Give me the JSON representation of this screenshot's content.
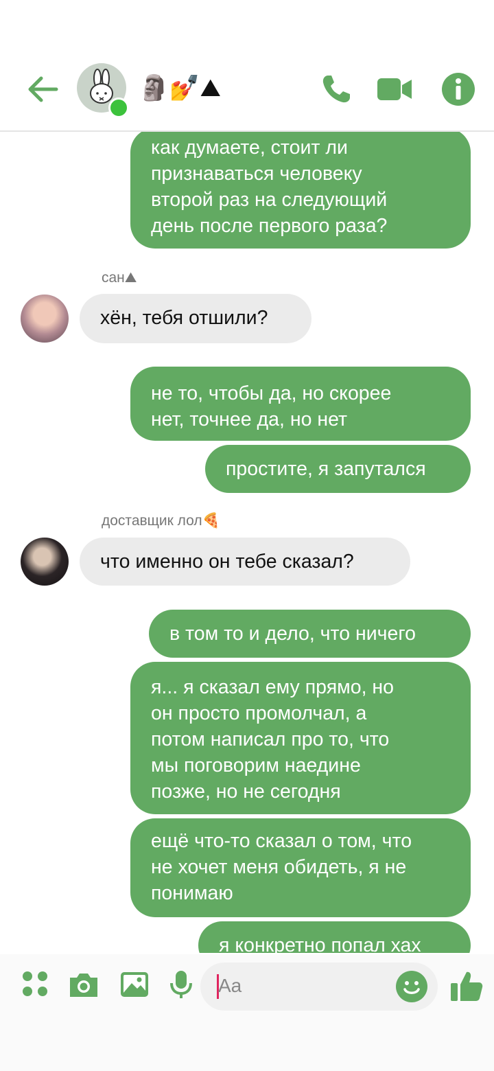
{
  "header": {
    "title_emojis": "🗿💅⛰",
    "back_icon": "arrow-left-icon",
    "call_icon": "phone-icon",
    "video_icon": "video-camera-icon",
    "info_icon": "info-icon"
  },
  "messages": [
    {
      "dir": "out",
      "lines": [
        "как думаете, стоит ли",
        "признаваться человеку",
        "второй раз на следующий",
        "день после первого раза?"
      ]
    },
    {
      "dir": "in",
      "sender": "сан⛰",
      "lines": [
        "хён, тебя отшили?"
      ]
    },
    {
      "dir": "out",
      "lines": [
        "не то, чтобы да, но скорее",
        "нет, точнее да, но нет"
      ]
    },
    {
      "dir": "out",
      "lines": [
        "простите, я запутался"
      ]
    },
    {
      "dir": "in",
      "sender": "доставщик лол🍕",
      "lines": [
        "что именно он тебе сказал?"
      ]
    },
    {
      "dir": "out",
      "lines": [
        "в том то и дело, что ничего"
      ]
    },
    {
      "dir": "out",
      "lines": [
        "я... я сказал ему прямо, но",
        "он просто промолчал, а",
        "потом написал про то, что",
        "мы поговорим наедине",
        "позже, но не сегодня"
      ]
    },
    {
      "dir": "out",
      "lines": [
        "ещё что-то сказал о том, что",
        "не хочет меня обидеть, я не",
        "понимаю"
      ]
    },
    {
      "dir": "out",
      "lines": [
        "я конкретно попал хах"
      ]
    }
  ],
  "composer": {
    "placeholder": "Aa",
    "icons": [
      "apps-grid-icon",
      "camera-icon",
      "image-icon",
      "microphone-icon",
      "emoji-icon",
      "thumbs-up-icon"
    ]
  },
  "colors": {
    "accent": "#62aa62",
    "incoming": "#ebebeb",
    "online": "#3cc23c"
  }
}
